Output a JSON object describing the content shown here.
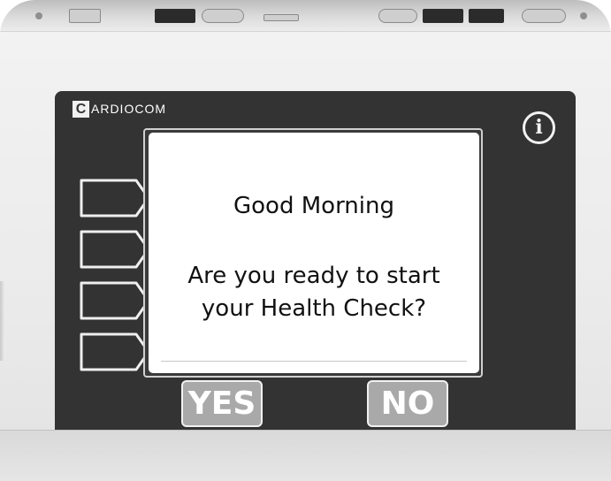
{
  "brand": {
    "initial": "C",
    "name": "ARDIOCOM"
  },
  "screen": {
    "greeting": "Good Morning",
    "question_lines": [
      "Are you ready to start",
      "your Health Check?"
    ]
  },
  "answers": {
    "yes_label": "YES",
    "no_label": "NO"
  },
  "info_button": {
    "icon": "info-icon",
    "glyph": "i"
  },
  "side_keys": {
    "count": 4,
    "icon": "arrow-key"
  },
  "colors": {
    "bezel": "#333333",
    "screen": "#ffffff",
    "device_shell": "#ebebeb",
    "answer_button": "#a9a9a9",
    "answer_text": "#ffffff"
  }
}
